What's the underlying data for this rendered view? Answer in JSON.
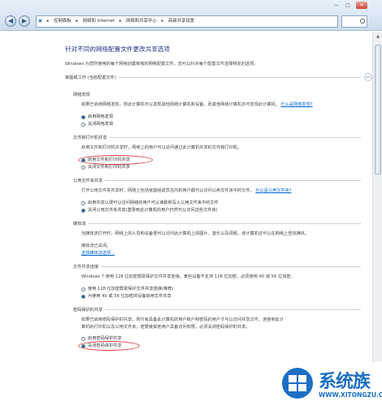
{
  "window": {
    "minimize": "—",
    "maximize": "□",
    "close": "✕"
  },
  "nav": {
    "back_icon": "arrow-left",
    "forward_icon": "arrow-right",
    "breadcrumb": [
      "控制面板",
      "网络和 Internet",
      "网络和共享中心",
      "高级共享设置"
    ]
  },
  "page": {
    "title": "针对不同的网络配置文件更改共享选项",
    "description": "Windows 为您所使用的每个网络创建单独的网络配置文件。您可以针对每个配置文件选择特定的选项。",
    "profile_header": "家庭或工作 (当前配置文件)"
  },
  "sections": [
    {
      "title": "网络发现",
      "body": "如果已启用网络发现，则此计算机可以发现其他网络计算机和设备，而其他网络计算机亦可发现此计算机。",
      "link": "什么是网络发现?",
      "options": [
        "启用网络发现",
        "关闭网络发现"
      ],
      "selected": 0
    },
    {
      "title": "文件和打印机共享",
      "body": "启用文件和打印机共享时，网络上的用户可以访问通过此计算机共享的文件和打印机。",
      "link": "",
      "options": [
        "启用文件和打印机共享",
        "关闭文件和打印机共享"
      ],
      "selected": 0
    },
    {
      "title": "公用文件夹共享",
      "body": "打开公用文件夹共享时，网络上包括家庭组成员在内的用户都可以访问公用文件夹中的文件。",
      "link": "什么是公用文件夹?",
      "options": [
        "启用共享以便可以访问网络的用户可以读取和写入公用文件夹中的文件",
        "关闭公用文件夹共享(登录到此计算机的用户仍然可以访问这些文件夹)"
      ],
      "selected": 1
    },
    {
      "title": "媒体流",
      "body": "当媒体流打开时，网络上的人员和设备便可以访问此计算机上的图片、音乐以及视频。该计算机还可以在网络上查找媒体。",
      "status": "媒体流已关闭。",
      "link": "选择媒体流选项...",
      "options": [],
      "selected": -1
    },
    {
      "title": "文件共享连接",
      "body": "Windows 7 使用 128 位加密帮助保护文件共享连接。某些设备不支持 128 位加密，必须使用 40 或 56 位加密。",
      "link": "",
      "options": [
        "使用 128 位加密帮助保护文件共享连接(推荐)",
        "为使用 40 或 56 位加密的设备启用文件共享"
      ],
      "selected": 1
    },
    {
      "title": "密码保护的共享",
      "body": "如果已启用密码保护的共享，则只有具备此计算机的用户帐户和密码的用户才可以访问共享文件、连接到此计算机的打印机以及公用文件夹。若要使其他用户具备访问权限，必须关闭密码保护的共享。",
      "link": "",
      "options": [
        "启用密码保护共享",
        "关闭密码保护共享"
      ],
      "selected": 1
    }
  ],
  "watermark": {
    "name": "系统族",
    "url": "WWW.XITONGZU.COM",
    "colors": {
      "primary": "#1c6fc4"
    }
  },
  "colors": {
    "title": "#1e3287",
    "link": "#0066cc",
    "highlight": "#e23b3b"
  }
}
